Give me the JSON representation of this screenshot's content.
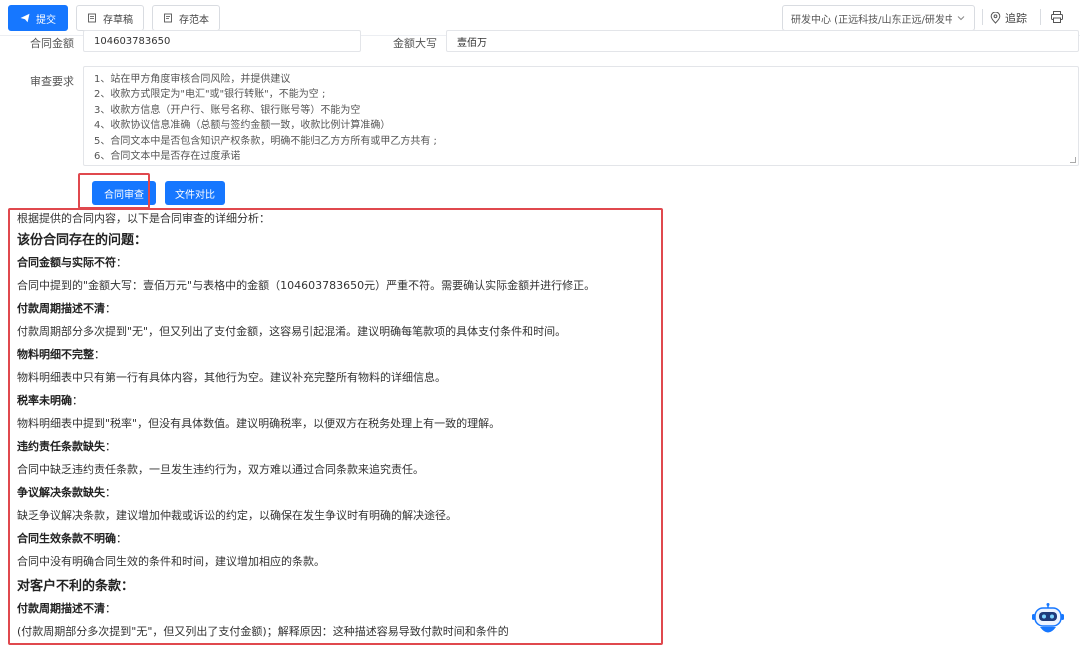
{
  "toolbar": {
    "submit_label": "提交",
    "draft_label": "存草稿",
    "template_label": "存范本",
    "org_select_value": "研发中心 (正远科技/山东正远/研发中",
    "trace_label": "追踪"
  },
  "form": {
    "amount_label": "合同金额",
    "amount_value": "104603783650",
    "amount_upper_label": "金额大写",
    "amount_upper_value": "壹佰万",
    "review_label": "审查要求",
    "review_lines": [
      "1、站在甲方角度审核合同风险，并提供建议",
      "2、收款方式限定为\"电汇\"或\"银行转账\"，不能为空 ;",
      "3、收款方信息（开户行、账号名称、银行账号等）不能为空",
      "4、收款协议信息准确（总额与签约金额一致，收款比例计算准确）",
      "5、合同文本中是否包含知识产权条款，明确不能归乙方方所有或甲乙方共有 ;",
      "6、合同文本中是否存在过度承诺"
    ],
    "review_button": "合同审查",
    "compare_button": "文件对比"
  },
  "result": {
    "intro": "根据提供的合同内容，以下是合同审查的详细分析：",
    "heading1": "该份合同存在的问题：",
    "issues": [
      {
        "title": "合同金额与实际不符",
        "text": "合同中提到的\"金额大写：壹佰万元\"与表格中的金额（104603783650元）严重不符。需要确认实际金额并进行修正。"
      },
      {
        "title": "付款周期描述不清",
        "text": "付款周期部分多次提到\"无\"，但又列出了支付金额，这容易引起混淆。建议明确每笔款项的具体支付条件和时间。"
      },
      {
        "title": "物料明细不完整",
        "text": "物料明细表中只有第一行有具体内容，其他行为空。建议补充完整所有物料的详细信息。"
      },
      {
        "title": "税率未明确",
        "text": "物料明细表中提到\"税率\"，但没有具体数值。建议明确税率，以便双方在税务处理上有一致的理解。"
      },
      {
        "title": "违约责任条款缺失",
        "text": "合同中缺乏违约责任条款，一旦发生违约行为，双方难以通过合同条款来追究责任。"
      },
      {
        "title": "争议解决条款缺失",
        "text": "缺乏争议解决条款，建议增加仲裁或诉讼的约定，以确保在发生争议时有明确的解决途径。"
      },
      {
        "title": "合同生效条款不明确",
        "text": "合同中没有明确合同生效的条件和时间，建议增加相应的条款。"
      }
    ],
    "heading2": "对客户不利的条款：",
    "unfavorable": [
      {
        "title": "付款周期描述不清",
        "text": "(付款周期部分多次提到\"无\"，但又列出了支付金额)；解释原因：这种描述容易导致付款时间和条件的"
      }
    ]
  },
  "colors": {
    "primary": "#1677ff",
    "highlight": "#e0484e"
  },
  "icons": [
    "send-icon",
    "draft-icon",
    "template-icon",
    "chevron-down-icon",
    "location-icon",
    "print-icon",
    "robot-assistant-icon"
  ]
}
